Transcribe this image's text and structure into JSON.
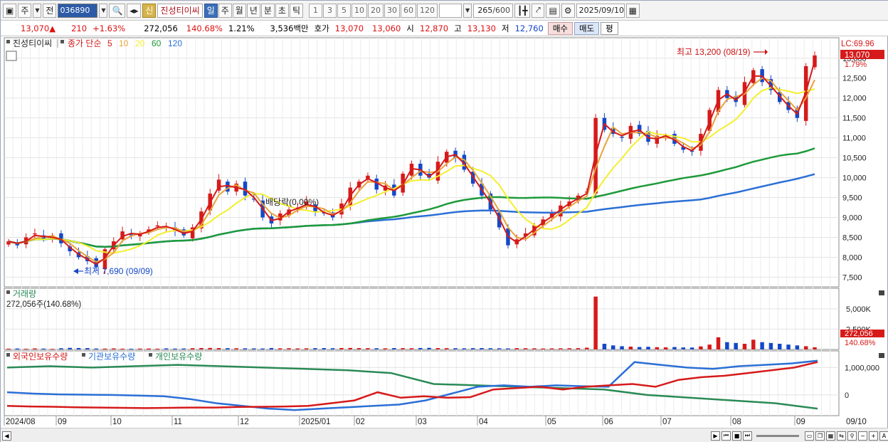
{
  "toolbar": {
    "market_label": "주",
    "prefix_label": "전",
    "stock_code": "036890",
    "badge": "신",
    "stock_name": "진성티이씨",
    "period_buttons": [
      "일",
      "주",
      "월",
      "년",
      "분",
      "초",
      "틱"
    ],
    "period_selected": "일",
    "intervals": [
      "1",
      "3",
      "5",
      "10",
      "20",
      "30",
      "60",
      "120"
    ],
    "count_display": "265",
    "count_total": "/600",
    "date_value": "2025/09/10"
  },
  "quote": {
    "price": "13,070",
    "arrow": "▲",
    "change": "210",
    "change_pct": "+1.63%",
    "volume": "272,056",
    "volume_ratio": "140.68%",
    "turnover_rate": "1.21%",
    "trade_amount": "3,536백만",
    "ask_label": "호가",
    "ask1": "13,070",
    "bid1": "13,060",
    "open_label": "시",
    "open": "12,870",
    "high_label": "고",
    "high": "13,130",
    "low_label": "저",
    "low": "12,760",
    "buy_button": "매수",
    "sell_button": "매도",
    "avg_button": "평"
  },
  "price_panel": {
    "stock_label": "진성티이씨",
    "ma_label_prefix": "종가 단순",
    "ma_periods": [
      "5",
      "10",
      "20",
      "60",
      "120"
    ],
    "ma_colors": [
      "#d61a1a",
      "#e8a33a",
      "#f3ef2e",
      "#1e9a3a",
      "#2b6fd6"
    ],
    "lc_label": "LC:69.96",
    "current_tag": "13,070",
    "current_pct": "1.79%",
    "high_annotation": "최고 13,200 (08/19)",
    "low_annotation": "최저 7,690 (09/09)",
    "dividend_annotation": "배당락(0.00%)",
    "y_ticks": [
      "13,000",
      "12,500",
      "12,000",
      "11,500",
      "11,000",
      "10,500",
      "10,000",
      "9,500",
      "9,000",
      "8,500",
      "8,000",
      "7,500"
    ]
  },
  "volume_panel": {
    "title": "거래량",
    "value": "272,056주(140.68%)",
    "y_ticks": [
      "5,000K",
      "2,500K"
    ],
    "tag_value": "272,056",
    "tag_pct": "140.68%"
  },
  "holdings_panel": {
    "legend": [
      "외국인보유수량",
      "기관보유수량",
      "개인보유수량"
    ],
    "legend_colors": [
      "#d61a1a",
      "#2b6fd6",
      "#2a8a55"
    ],
    "y_ticks": [
      "1,000,000",
      "0"
    ]
  },
  "x_axis": {
    "labels": [
      "2024/08",
      "09",
      "10",
      "11",
      "12",
      "2025/01",
      "02",
      "03",
      "04",
      "05",
      "06",
      "07",
      "08",
      "09"
    ],
    "end_label": "09/10"
  },
  "chart_data": {
    "type": "candlestick",
    "title": "진성티이씨",
    "x_start": "2024/08",
    "x_end": "2025/09/10",
    "ylim": [
      7400,
      13300
    ],
    "price_close": [
      8400,
      8300,
      8500,
      8600,
      8450,
      8550,
      8350,
      8150,
      8000,
      7900,
      7750,
      8200,
      8400,
      8650,
      8550,
      8600,
      8700,
      8800,
      8750,
      8650,
      8550,
      8750,
      9150,
      9600,
      9950,
      9650,
      9850,
      9550,
      9450,
      9000,
      8850,
      9100,
      9200,
      9250,
      9400,
      9150,
      9100,
      9000,
      9350,
      9750,
      9900,
      10050,
      9700,
      9800,
      9550,
      10100,
      10350,
      10050,
      10000,
      10400,
      10650,
      10500,
      10200,
      9850,
      9550,
      9200,
      8750,
      8300,
      8450,
      8600,
      8800,
      8950,
      9100,
      9300,
      9400,
      9550,
      9650,
      11500,
      11200,
      11100,
      11000,
      11300,
      11100,
      10900,
      11050,
      11050,
      10850,
      10700,
      10650,
      11100,
      11700,
      12200,
      12000,
      11900,
      12400,
      12700,
      12400,
      12200,
      11900,
      11700,
      11500,
      12800,
      13070
    ],
    "volume_k": [
      100,
      120,
      90,
      130,
      110,
      80,
      150,
      200,
      180,
      170,
      120,
      110,
      130,
      100,
      90,
      110,
      120,
      100,
      130,
      110,
      120,
      160,
      180,
      190,
      170,
      160,
      150,
      140,
      130,
      120,
      180,
      140,
      150,
      130,
      140,
      160,
      170,
      150,
      180,
      190,
      170,
      160,
      150,
      140,
      170,
      160,
      150,
      180,
      200,
      170,
      160,
      150,
      140,
      160,
      170,
      150,
      140,
      130,
      160,
      150,
      140,
      120,
      130,
      140,
      150,
      160,
      220,
      6500,
      700,
      500,
      400,
      350,
      300,
      330,
      280,
      260,
      300,
      250,
      240,
      380,
      600,
      1500,
      900,
      800,
      700,
      1200,
      900,
      800,
      700,
      600,
      500,
      400,
      272
    ],
    "foreign_holdings": [
      -400000,
      -420000,
      -430000,
      -450000,
      -460000,
      -470000,
      -480000,
      -470000,
      -460000,
      -460000,
      -440000,
      -430000,
      -420000,
      -400000,
      -300000,
      -200000,
      100000,
      -100000,
      -50000,
      -100000,
      -80000,
      200000,
      250000,
      300000,
      200000,
      300000,
      350000,
      400000,
      300000,
      550000,
      650000,
      700000,
      800000,
      900000,
      1000000,
      1200000
    ],
    "institution_holdings": [
      100000,
      50000,
      20000,
      10000,
      0,
      -20000,
      -50000,
      -150000,
      -300000,
      -400000,
      -500000,
      -550000,
      -500000,
      -450000,
      -400000,
      -350000,
      -200000,
      50000,
      300000,
      350000,
      300000,
      350000,
      320000,
      300000,
      1200000,
      1100000,
      1000000,
      950000,
      1050000,
      1100000,
      1150000,
      1250000
    ],
    "individual_holdings": [
      1000000,
      1050000,
      1000000,
      1050000,
      1100000,
      1050000,
      1000000,
      950000,
      900000,
      800000,
      400000,
      350000,
      300000,
      250000,
      200000,
      0,
      -100000,
      -200000,
      -300000,
      -500000
    ]
  }
}
